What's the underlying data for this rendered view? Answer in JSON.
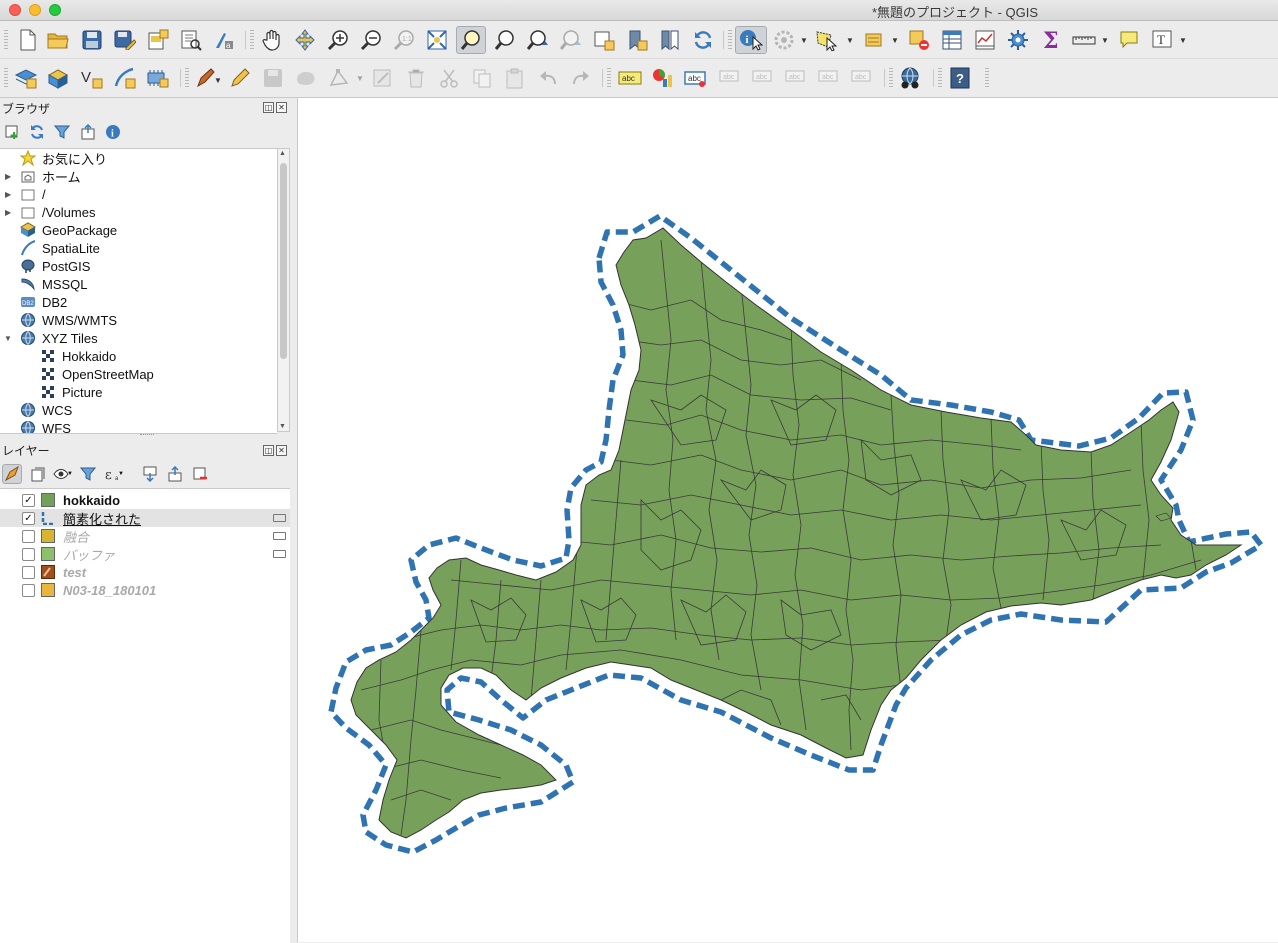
{
  "window": {
    "title": "*無題のプロジェクト - QGIS"
  },
  "panels": {
    "browser": {
      "title": "ブラウザ",
      "items": [
        {
          "label": "お気に入り",
          "icon": "star-icon",
          "expandable": false
        },
        {
          "label": "ホーム",
          "icon": "home-folder-icon",
          "expandable": true
        },
        {
          "label": "/",
          "icon": "folder-icon",
          "expandable": true
        },
        {
          "label": "/Volumes",
          "icon": "folder-icon",
          "expandable": true
        },
        {
          "label": "GeoPackage",
          "icon": "geopackage-icon",
          "expandable": false
        },
        {
          "label": "SpatiaLite",
          "icon": "spatialite-icon",
          "expandable": false
        },
        {
          "label": "PostGIS",
          "icon": "postgis-icon",
          "expandable": false
        },
        {
          "label": "MSSQL",
          "icon": "mssql-icon",
          "expandable": false
        },
        {
          "label": "DB2",
          "icon": "db2-icon",
          "expandable": false
        },
        {
          "label": "WMS/WMTS",
          "icon": "globe-icon",
          "expandable": false
        },
        {
          "label": "XYZ Tiles",
          "icon": "globe-icon",
          "expandable": true,
          "expanded": true
        },
        {
          "label": "Hokkaido",
          "icon": "tiles-icon",
          "child": true
        },
        {
          "label": "OpenStreetMap",
          "icon": "tiles-icon",
          "child": true
        },
        {
          "label": "Picture",
          "icon": "tiles-icon",
          "child": true
        },
        {
          "label": "WCS",
          "icon": "globe-icon",
          "expandable": false
        },
        {
          "label": "WFS",
          "icon": "globe-icon",
          "expandable": false
        }
      ]
    },
    "layers": {
      "title": "レイヤー",
      "items": [
        {
          "name": "hokkaido",
          "checked": true,
          "visible": true,
          "bold": true,
          "swatch": "#72a05a",
          "selected": false,
          "memory": false
        },
        {
          "name": "簡素化された",
          "checked": true,
          "visible": true,
          "bold": false,
          "swatch": "dashed-line",
          "selected": true,
          "memory": true
        },
        {
          "name": "融合",
          "checked": false,
          "visible": false,
          "bold": false,
          "swatch": "#d8b531",
          "selected": false,
          "memory": true
        },
        {
          "name": "バッファ",
          "checked": false,
          "visible": false,
          "bold": false,
          "swatch": "#8dc06b",
          "selected": false,
          "memory": true
        },
        {
          "name": "test",
          "checked": false,
          "visible": false,
          "bold": true,
          "swatch": "#a0501e",
          "selected": false,
          "memory": false
        },
        {
          "name": "N03-18_180101",
          "checked": false,
          "visible": false,
          "bold": true,
          "swatch": "#e8b63a",
          "selected": false,
          "memory": false
        }
      ]
    }
  },
  "map": {
    "land_color": "#77a05a",
    "border_color": "#333333",
    "outline_color": "#2f74b0"
  },
  "colors": {
    "accent": "#2f74b0",
    "selected_row": "#e3e3e3"
  }
}
